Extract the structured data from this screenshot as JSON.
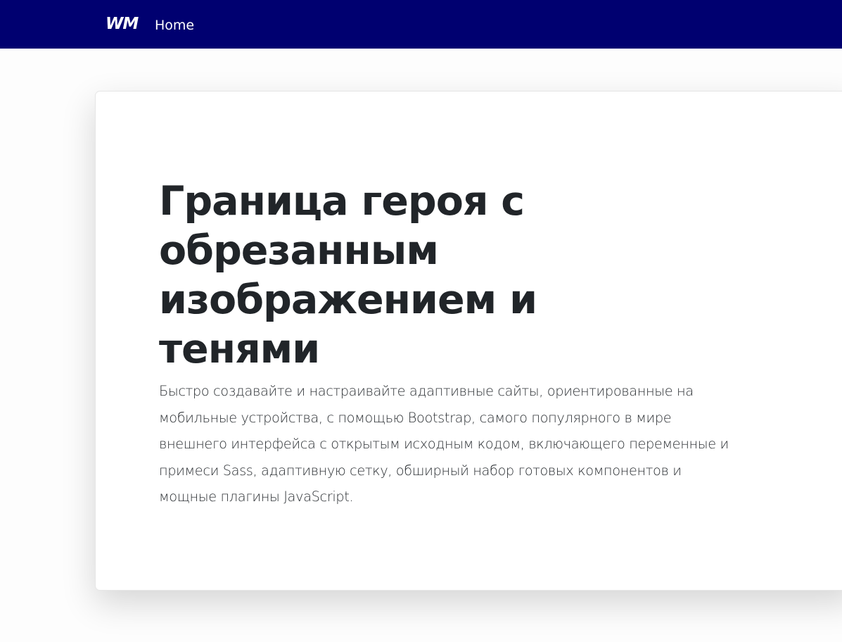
{
  "navbar": {
    "brand": "WM",
    "links": [
      {
        "label": "Home"
      }
    ]
  },
  "hero": {
    "title": "Граница героя с обрезанным изображением и тенями",
    "lead": "Быстро создавайте и настраивайте адаптивные сайты, ориентированные на мобильные устройства, с помощью Bootstrap, самого популярного в мире внешнего интерфейса с открытым исходным кодом, включающего переменные и примеси Sass, адаптивную сетку, обширный набор готовых компонентов и мощные плагины JavaScript."
  },
  "colors": {
    "navbar_bg": "#000070",
    "text_dark": "#212529",
    "card_bg": "#ffffff"
  }
}
